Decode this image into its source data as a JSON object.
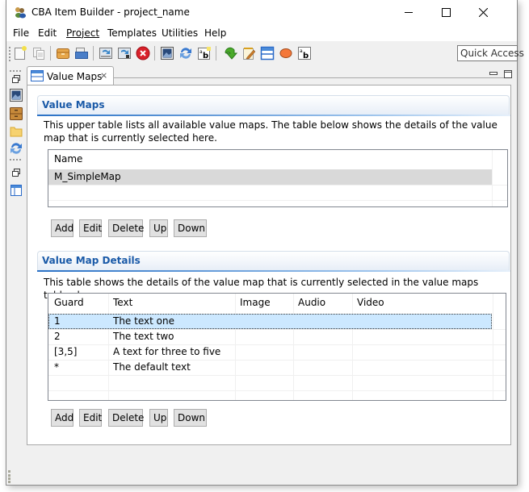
{
  "window": {
    "title": "CBA Item Builder - project_name",
    "controls": [
      "minimize",
      "maximize",
      "close"
    ]
  },
  "menu": {
    "items": [
      {
        "label": "File"
      },
      {
        "label": "Edit"
      },
      {
        "label": "Project"
      },
      {
        "label": "Templates"
      },
      {
        "label": "Utilities"
      },
      {
        "label": "Help"
      }
    ]
  },
  "toolbar": {
    "icons": [
      "new-file-icon",
      "copy-icon",
      "archive-icon",
      "open-folder-icon",
      "import-icon",
      "export-icon",
      "stop-icon",
      "image-icon",
      "refresh-icon",
      "text-box-icon",
      "download-icon",
      "edit-note-icon",
      "value-map-icon",
      "ellipse-icon",
      "text-icon"
    ],
    "quick_access": "Quick Access"
  },
  "left_trim": {
    "icons": [
      "restore-icon",
      "image-view-icon",
      "cabinet-icon",
      "folder-icon",
      "sync-icon",
      "restore-icon-2",
      "layout-icon"
    ]
  },
  "editor": {
    "tab_label": "Value Maps",
    "value_maps": {
      "title": "Value Maps",
      "description": "This upper table lists all available value maps. The table below shows the details of the value map that is currently selected here.",
      "columns": [
        "Name"
      ],
      "rows": [
        {
          "name": "M_SimpleMap",
          "selected": true
        }
      ],
      "buttons": [
        "Add",
        "Edit",
        "Delete",
        "Up",
        "Down"
      ]
    },
    "details": {
      "title": "Value Map Details",
      "description": "This table shows the details of the value map that is currently selected in the value maps table above.",
      "columns": [
        "Guard",
        "Text",
        "Image",
        "Audio",
        "Video"
      ],
      "rows": [
        {
          "guard": "1",
          "text": "The text one",
          "image": "",
          "audio": "",
          "video": "",
          "selected": true
        },
        {
          "guard": "2",
          "text": "The text two",
          "image": "",
          "audio": "",
          "video": ""
        },
        {
          "guard": "[3,5]",
          "text": "A text for three to five",
          "image": "",
          "audio": "",
          "video": ""
        },
        {
          "guard": "*",
          "text": "The default text",
          "image": "",
          "audio": "",
          "video": ""
        }
      ],
      "buttons": [
        "Add",
        "Edit",
        "Delete",
        "Up",
        "Down"
      ]
    }
  },
  "colors": {
    "section_title": "#1a5aa8",
    "selection_light": "#cce8ff",
    "selection_gray": "#d9d9d9"
  }
}
